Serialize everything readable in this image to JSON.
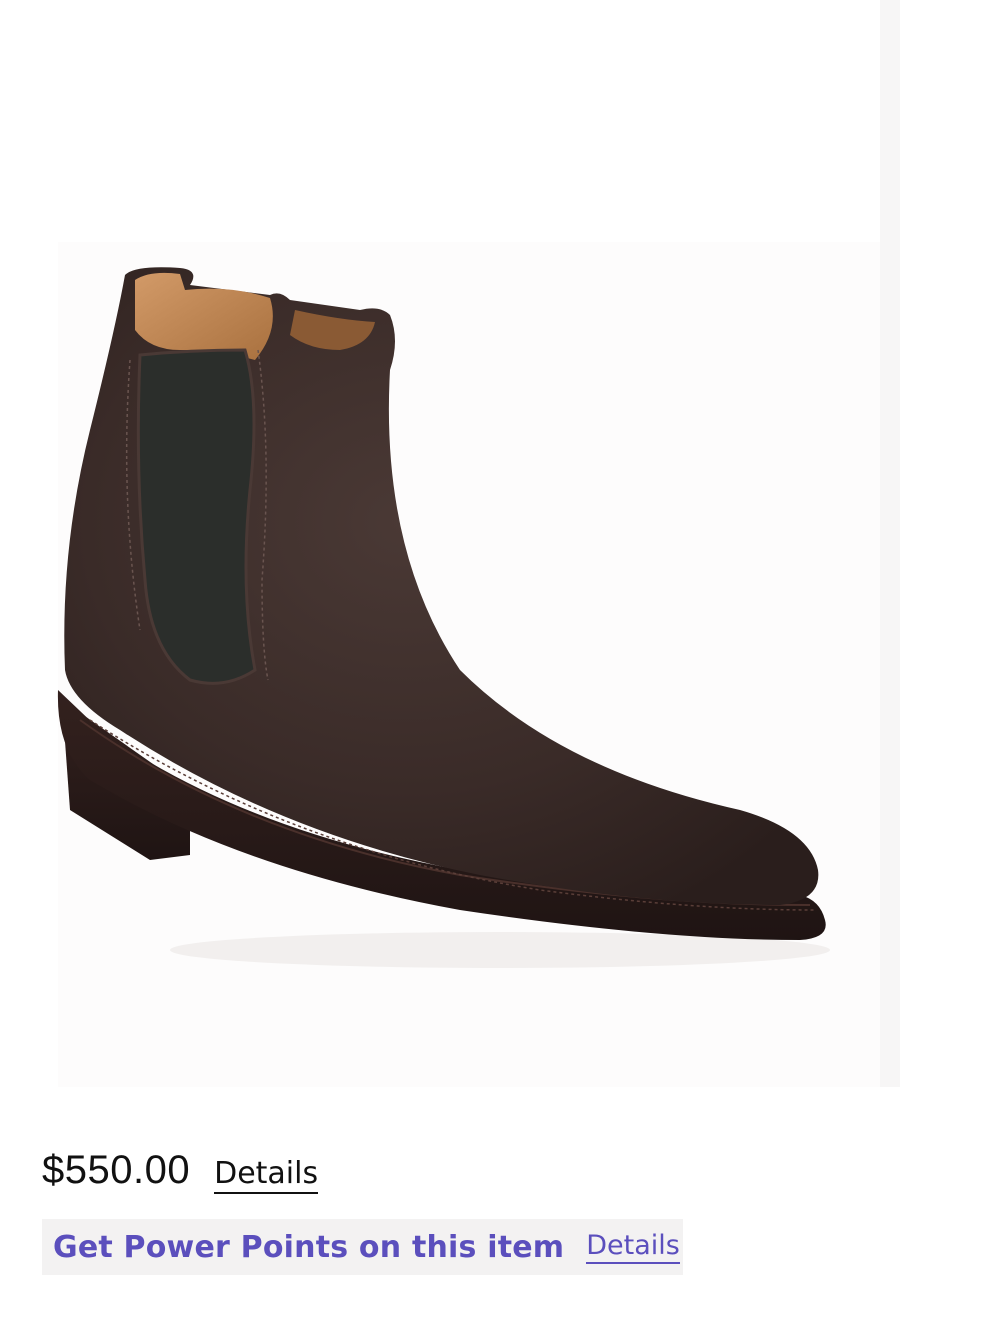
{
  "product": {
    "image_alt": "Chelsea boot",
    "image_colors": {
      "suede": "#3a2b28",
      "elastic": "#2b2e2b",
      "lining": "#c48e5f",
      "sole": "#2a1b19"
    },
    "favorite_icon": "heart-outline-icon"
  },
  "pricing": {
    "price": "$550.00",
    "details_label": "Details"
  },
  "rewards": {
    "text": "Get Power Points on this item",
    "details_label": "Details",
    "accent_color": "#5b4fbd"
  }
}
